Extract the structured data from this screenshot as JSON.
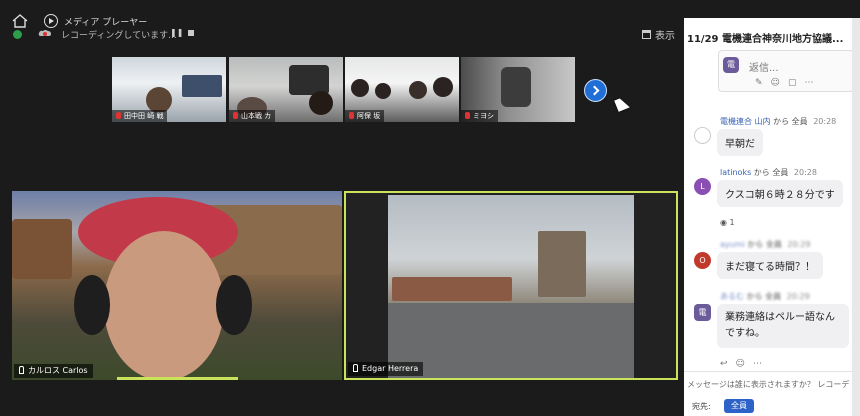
{
  "topbar": {
    "app_title": "メディア プレーヤー",
    "recording_text": "レコーディングしています...",
    "pause_glyph": "❚❚",
    "show_label": "表示"
  },
  "thumbnails": [
    {
      "label": "田中田 崎 戦",
      "id": "t1"
    },
    {
      "label": "山本戦 カ",
      "id": "t2"
    },
    {
      "label": "阿保 坂",
      "id": "t3"
    },
    {
      "label": "ミヨシ",
      "id": "t4"
    }
  ],
  "tiles": {
    "carlos": "カルロス Carlos",
    "edgar": "Edgar Herrera"
  },
  "chat": {
    "title": "11/29 電機連合神奈川地方協議...",
    "reply_placeholder": "返信...",
    "reply_avatar": "電",
    "messages": [
      {
        "sender": "電機連合 山内",
        "from": "から 全員",
        "time": "20:28",
        "text": "早朝だ",
        "avatar": "",
        "avatar_color": "#ffffff"
      },
      {
        "sender": "latinoks",
        "from": "から 全員",
        "time": "20:28",
        "text": "クスコ朝６時２８分です",
        "avatar": "L",
        "avatar_color": "#8a4fb3"
      },
      {
        "sender": "ayumi",
        "from": "から 全員",
        "time": "20:29",
        "text": "まだ寝てる時間？！",
        "avatar": "O",
        "avatar_color": "#c0392b"
      },
      {
        "sender": "あるむ",
        "from": "から 全員",
        "time": "20:29",
        "text": "業務連絡はペルー語なんですね。",
        "avatar": "電",
        "avatar_color": "#6b5b9a"
      }
    ],
    "reaction_count": "1",
    "message_placeholder": "メッセージは誰に表示されますか？ レコーデ",
    "to_label": "宛先:",
    "to_value": "全員"
  }
}
